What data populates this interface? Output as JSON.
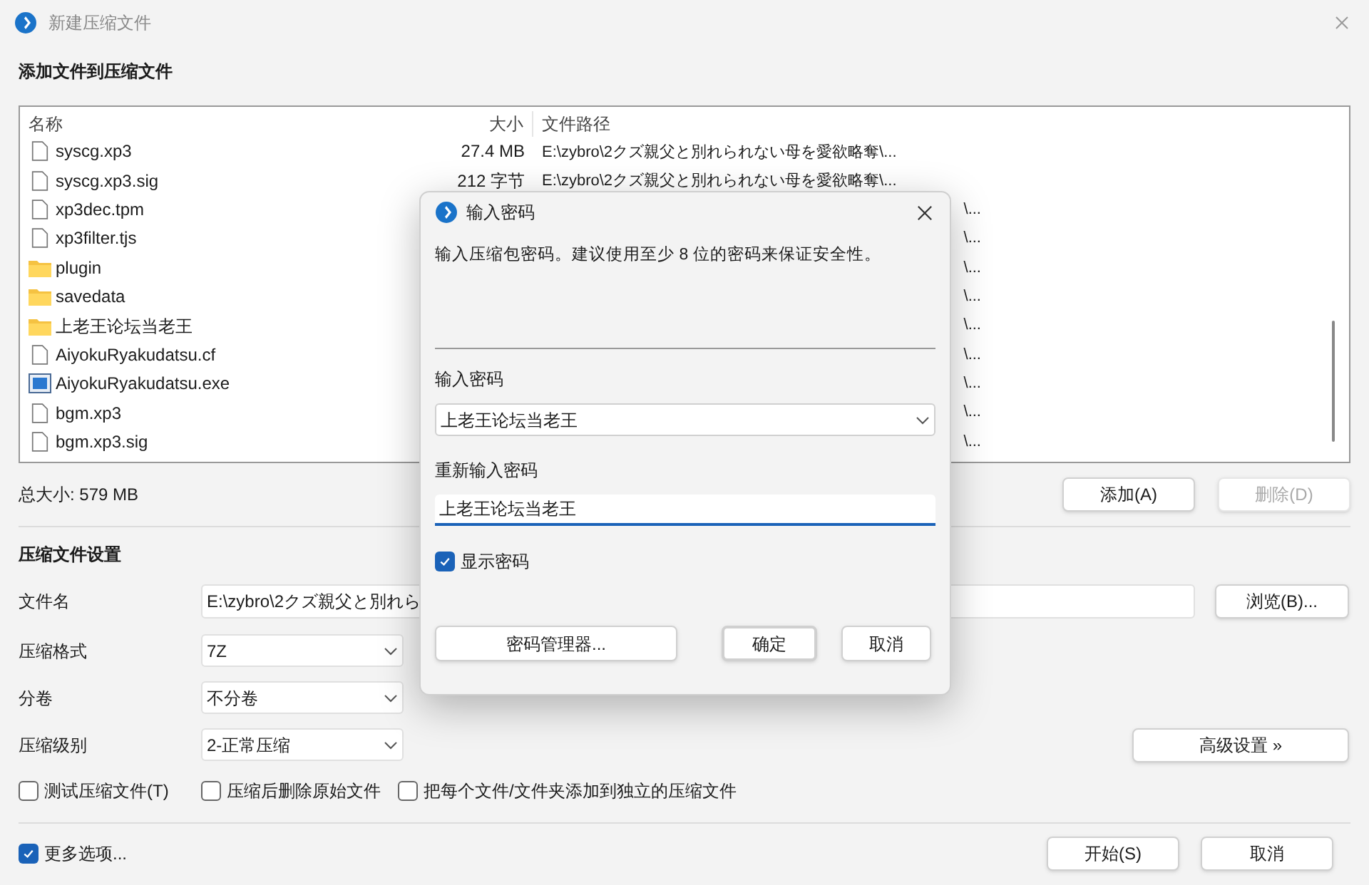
{
  "window": {
    "title": "新建压缩文件"
  },
  "add_section": {
    "heading": "添加文件到压缩文件"
  },
  "file_list": {
    "columns": [
      "名称",
      "大小",
      "文件路径"
    ],
    "rows": [
      {
        "kind": "file",
        "name": "syscg.xp3",
        "size": "27.4 MB",
        "path": "E:\\zybro\\2クズ親父と別れられない母を愛欲略奪\\..."
      },
      {
        "kind": "file",
        "name": "syscg.xp3.sig",
        "size": "212 字节",
        "path": "E:\\zybro\\2クズ親父と別れられない母を愛欲略奪\\..."
      },
      {
        "kind": "file",
        "name": "xp3dec.tpm",
        "path": "\\..."
      },
      {
        "kind": "file",
        "name": "xp3filter.tjs",
        "path": "\\..."
      },
      {
        "kind": "folder",
        "name": "plugin",
        "path": "\\..."
      },
      {
        "kind": "folder",
        "name": "savedata",
        "path": "\\..."
      },
      {
        "kind": "folder",
        "name": "上老王论坛当老王",
        "path": "\\..."
      },
      {
        "kind": "file",
        "name": "AiyokuRyakudatsu.cf",
        "path": "\\..."
      },
      {
        "kind": "exe",
        "name": "AiyokuRyakudatsu.exe",
        "path": "\\..."
      },
      {
        "kind": "file",
        "name": "bgm.xp3",
        "path": "\\..."
      },
      {
        "kind": "file",
        "name": "bgm.xp3.sig",
        "path": "\\..."
      }
    ]
  },
  "total_size": "总大小: 579 MB",
  "list_buttons": [
    {
      "label": "添加(A)",
      "disabled": false
    },
    {
      "label": "删除(D)",
      "disabled": true
    }
  ],
  "settings": {
    "heading": "压缩文件设置",
    "filename": {
      "label": "文件名",
      "value": "E:\\zybro\\2クズ親父と別れら",
      "browse": "浏览(B)..."
    },
    "selects": [
      {
        "label": "压缩格式",
        "value": "7Z"
      },
      {
        "label": "分卷",
        "value": "不分卷"
      },
      {
        "label": "压缩级别",
        "value": "2-正常压缩"
      }
    ],
    "advanced_button": "高级设置 »",
    "options": [
      {
        "label": "测试压缩文件(T)",
        "checked": false
      },
      {
        "label": "压缩后删除原始文件",
        "checked": false
      },
      {
        "label": "把每个文件/文件夹添加到独立的压缩文件",
        "checked": false
      }
    ]
  },
  "more_options": {
    "label": "更多选项...",
    "checked": true
  },
  "footer_buttons": [
    "开始(S)",
    "取消"
  ],
  "password_dialog": {
    "title": "输入密码",
    "description": "输入压缩包密码。建议使用至少 8 位的密码来保证安全性。",
    "password_label": "输入密码",
    "password_value": "上老王论坛当老王",
    "confirm_label": "重新输入密码",
    "confirm_value": "上老王论坛当老王",
    "show_password": {
      "label": "显示密码",
      "checked": true
    },
    "buttons": [
      {
        "label": "密码管理器...",
        "default": false
      },
      {
        "label": "确定",
        "default": true
      },
      {
        "label": "取消",
        "default": false
      }
    ]
  }
}
